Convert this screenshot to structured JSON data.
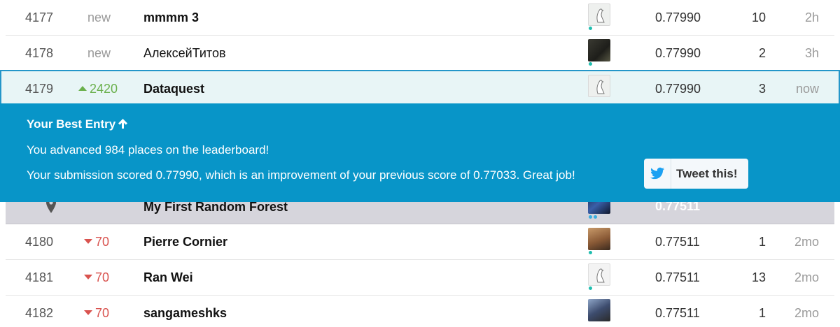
{
  "leaderboard": {
    "rows": [
      {
        "rank": "4177",
        "change": "new",
        "change_type": "new",
        "team": "mmmm 3",
        "avatar": "default-goose-avatar",
        "score": "0.77990",
        "entries": "10",
        "last": "2h"
      },
      {
        "rank": "4178",
        "change": "new",
        "change_type": "new",
        "team": "АлексейТитов",
        "avatar": "user-photo-avatar",
        "score": "0.77990",
        "entries": "2",
        "last": "3h"
      },
      {
        "rank": "4179",
        "change": "2420",
        "change_type": "up",
        "team": "Dataquest",
        "avatar": "default-goose-avatar",
        "score": "0.77990",
        "entries": "3",
        "last": "now"
      },
      {
        "rank": "",
        "change": "",
        "change_type": "pinned",
        "team": "My First Random Forest",
        "avatar": "team-avatar",
        "score": "0.77511",
        "entries": "",
        "last": ""
      },
      {
        "rank": "4180",
        "change": "70",
        "change_type": "down",
        "team": "Pierre Cornier",
        "avatar": "user-photo-avatar",
        "score": "0.77511",
        "entries": "1",
        "last": "2mo"
      },
      {
        "rank": "4181",
        "change": "70",
        "change_type": "down",
        "team": "Ran Wei",
        "avatar": "default-goose-avatar",
        "score": "0.77511",
        "entries": "13",
        "last": "2mo"
      },
      {
        "rank": "4182",
        "change": "70",
        "change_type": "down",
        "team": "sangameshks",
        "avatar": "user-photo-avatar",
        "score": "0.77511",
        "entries": "1",
        "last": "2mo"
      }
    ]
  },
  "banner": {
    "title": "Your Best Entry",
    "line1": "You advanced 984 places on the leaderboard!",
    "line2": "Your submission scored 0.77990, which is an improvement of your previous score of 0.77033. Great job!",
    "tweet_label": "Tweet this!",
    "tweet_icon": "twitter-bird-icon"
  },
  "colors": {
    "banner_bg": "#0895c8",
    "highlight_bg": "#e8f5f6",
    "highlight_border": "#2496c9",
    "up": "#6ab04c",
    "down": "#d9534f",
    "tier_dot": "#20beaf"
  }
}
